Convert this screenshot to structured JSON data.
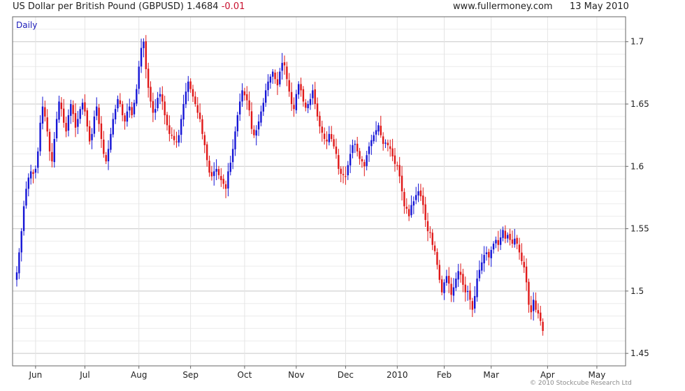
{
  "header": {
    "title": "US Dollar per British Pound (GBPUSD)",
    "last": "1.4684",
    "change": "-0.01",
    "site": "www.fullermoney.com",
    "date": "13 May 2010"
  },
  "footer": {
    "copyright": "© 2010 Stockcube Research Ltd"
  },
  "colors": {
    "up": "#1515d6",
    "down": "#e01818",
    "grid": "#d9d9d9",
    "frame": "#666666"
  },
  "chart_data": {
    "type": "ohlc-bar",
    "interval_label": "Daily",
    "title": "US Dollar per British Pound (GBPUSD)",
    "y_axis": {
      "position": "right",
      "ylim": [
        1.44,
        1.72
      ],
      "ticks": [
        1.45,
        1.5,
        1.55,
        1.6,
        1.65,
        1.7
      ],
      "tick_labels": [
        "1.45",
        "1.5",
        "1.55",
        "1.6",
        "1.65",
        "1.7"
      ]
    },
    "x_axis": {
      "tick_labels": [
        "Jun",
        "Jul",
        "Aug",
        "Sep",
        "Oct",
        "Nov",
        "Dec",
        "2010",
        "Feb",
        "Mar",
        "Apr",
        "May"
      ],
      "tick_trading_day": [
        8,
        29,
        52,
        74,
        97,
        119,
        140,
        162,
        182,
        202,
        226,
        247
      ]
    },
    "grid": true,
    "closes": [
      1.515,
      1.531,
      1.548,
      1.568,
      1.582,
      1.591,
      1.596,
      1.594,
      1.598,
      1.612,
      1.635,
      1.648,
      1.64,
      1.628,
      1.612,
      1.604,
      1.622,
      1.638,
      1.652,
      1.646,
      1.635,
      1.628,
      1.641,
      1.65,
      1.642,
      1.631,
      1.638,
      1.646,
      1.651,
      1.644,
      1.632,
      1.62,
      1.626,
      1.64,
      1.648,
      1.634,
      1.622,
      1.61,
      1.604,
      1.614,
      1.626,
      1.638,
      1.646,
      1.654,
      1.65,
      1.641,
      1.636,
      1.644,
      1.648,
      1.641,
      1.651,
      1.662,
      1.68,
      1.695,
      1.7,
      1.678,
      1.663,
      1.652,
      1.643,
      1.646,
      1.655,
      1.658,
      1.652,
      1.641,
      1.633,
      1.626,
      1.625,
      1.621,
      1.62,
      1.625,
      1.638,
      1.65,
      1.66,
      1.668,
      1.662,
      1.656,
      1.65,
      1.643,
      1.638,
      1.626,
      1.617,
      1.605,
      1.595,
      1.592,
      1.596,
      1.598,
      1.593,
      1.589,
      1.586,
      1.582,
      1.596,
      1.603,
      1.614,
      1.628,
      1.641,
      1.652,
      1.661,
      1.657,
      1.653,
      1.645,
      1.63,
      1.625,
      1.629,
      1.636,
      1.644,
      1.651,
      1.661,
      1.668,
      1.672,
      1.676,
      1.67,
      1.665,
      1.676,
      1.683,
      1.681,
      1.67,
      1.66,
      1.65,
      1.646,
      1.658,
      1.666,
      1.661,
      1.652,
      1.647,
      1.65,
      1.654,
      1.661,
      1.65,
      1.64,
      1.632,
      1.627,
      1.622,
      1.62,
      1.626,
      1.622,
      1.616,
      1.61,
      1.598,
      1.594,
      1.593,
      1.592,
      1.601,
      1.61,
      1.617,
      1.618,
      1.612,
      1.606,
      1.604,
      1.6,
      1.609,
      1.616,
      1.621,
      1.625,
      1.629,
      1.633,
      1.625,
      1.618,
      1.619,
      1.617,
      1.614,
      1.608,
      1.602,
      1.601,
      1.592,
      1.58,
      1.568,
      1.566,
      1.56,
      1.569,
      1.572,
      1.577,
      1.58,
      1.576,
      1.569,
      1.557,
      1.548,
      1.547,
      1.537,
      1.532,
      1.521,
      1.509,
      1.499,
      1.507,
      1.512,
      1.506,
      1.497,
      1.503,
      1.51,
      1.516,
      1.513,
      1.505,
      1.499,
      1.5,
      1.493,
      1.485,
      1.496,
      1.51,
      1.517,
      1.523,
      1.529,
      1.531,
      1.527,
      1.533,
      1.538,
      1.541,
      1.537,
      1.543,
      1.549,
      1.542,
      1.545,
      1.541,
      1.538,
      1.542,
      1.538,
      1.531,
      1.524,
      1.519,
      1.507,
      1.489,
      1.483,
      1.493,
      1.485,
      1.482,
      1.476,
      1.468
    ]
  }
}
